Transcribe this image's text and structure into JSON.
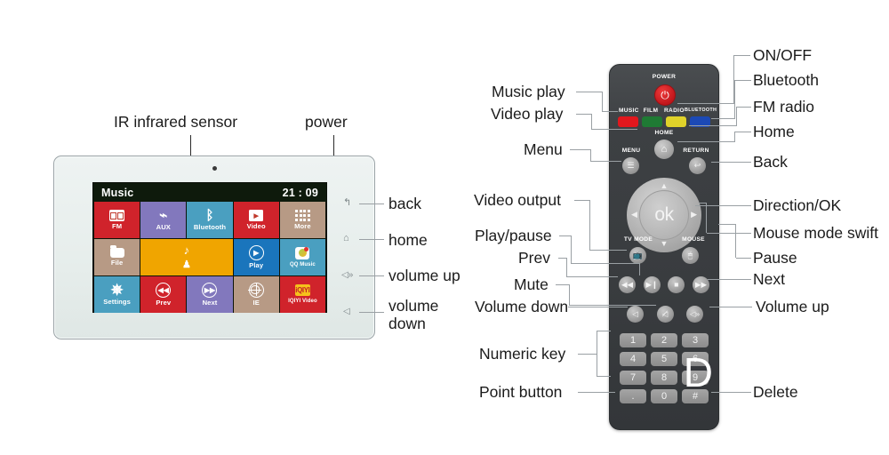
{
  "tablet": {
    "callouts_top": [
      {
        "label": "IR infrared sensor"
      },
      {
        "label": "power"
      }
    ],
    "side_keys": [
      {
        "icon": "back-icon",
        "glyph": "↰",
        "label": "back"
      },
      {
        "icon": "home-icon",
        "glyph": "⌂",
        "label": "home"
      },
      {
        "icon": "volume-up-icon",
        "glyph": "◁»",
        "label": "volume up"
      },
      {
        "icon": "volume-down-icon",
        "glyph": "◁",
        "label": "volume down"
      }
    ],
    "screen": {
      "status_title": "Music",
      "status_time": "21 : 09",
      "tiles": [
        {
          "label": "FM",
          "icon": "fm-radio-icon",
          "color": "#d0232b",
          "span": 1
        },
        {
          "label": "AUX",
          "icon": "aux-cable-icon",
          "color": "#8278bd",
          "span": 1
        },
        {
          "label": "Bluetooth",
          "icon": "bluetooth-icon",
          "color": "#4a9fc0",
          "span": 1
        },
        {
          "label": "Video",
          "icon": "video-icon",
          "color": "#d0232b",
          "span": 1
        },
        {
          "label": "More",
          "icon": "more-dots-icon",
          "color": "#b79a85",
          "span": 1
        },
        {
          "label": "File",
          "icon": "folder-icon",
          "color": "#b79a85",
          "span": 1
        },
        {
          "label": "",
          "icon": "music-note-icon",
          "color": "#f0a500",
          "span": 2
        },
        {
          "label": "Play",
          "icon": "play-icon",
          "color": "#1a75bc",
          "span": 1
        },
        {
          "label": "QQ Music",
          "icon": "qq-music-icon",
          "color": "#4a9fc0",
          "span": 1
        },
        {
          "label": "Settings",
          "icon": "gear-icon",
          "color": "#4a9fc0",
          "span": 1
        },
        {
          "label": "Prev",
          "icon": "prev-icon",
          "color": "#d0232b",
          "span": 1
        },
        {
          "label": "Next",
          "icon": "next-icon",
          "color": "#8278bd",
          "span": 1
        },
        {
          "label": "IE",
          "icon": "globe-icon",
          "color": "#b79a85",
          "span": 1
        },
        {
          "label": "IQIYI Video",
          "icon": "iqiyi-icon",
          "color": "#d0232b",
          "span": 1
        }
      ]
    }
  },
  "remote": {
    "printed_labels": {
      "power": "POWER",
      "music": "MUSIC",
      "film": "FILM",
      "radio": "RADIO",
      "bluetooth": "BLUETOOTH",
      "home": "HOME",
      "menu": "MENU",
      "return": "RETURN",
      "tv_mode": "TV MODE",
      "mouse": "MOUSE",
      "ok": "ok"
    },
    "color_buttons": [
      {
        "name": "music",
        "color": "#e1171d"
      },
      {
        "name": "film",
        "color": "#1f7a34"
      },
      {
        "name": "radio",
        "color": "#e0d22a"
      },
      {
        "name": "bluetooth",
        "color": "#1c49b5"
      }
    ],
    "media_buttons": [
      {
        "name": "prev",
        "glyph": "◀◀"
      },
      {
        "name": "play-pause",
        "glyph": "▶❙"
      },
      {
        "name": "stop-pause",
        "glyph": "■"
      },
      {
        "name": "next",
        "glyph": "▶▶"
      }
    ],
    "volume_buttons": [
      {
        "name": "volume-down",
        "glyph": "◁"
      },
      {
        "name": "mute",
        "glyph": "◁̸"
      },
      {
        "name": "volume-up",
        "glyph": "◁»"
      }
    ],
    "keypad": [
      "1",
      "2",
      "3",
      "4",
      "5",
      "6",
      "7",
      "8",
      "9",
      ".",
      "0",
      "#"
    ],
    "delete_watermark": "D"
  },
  "callouts_left": [
    {
      "label": "Music play"
    },
    {
      "label": "Video play"
    },
    {
      "label": "Menu"
    },
    {
      "label": "Video output"
    },
    {
      "label": "Play/pause"
    },
    {
      "label": "Prev"
    },
    {
      "label": "Mute"
    },
    {
      "label": "Volume down"
    },
    {
      "label": "Numeric key"
    },
    {
      "label": "Point button"
    }
  ],
  "callouts_right": [
    {
      "label": "ON/OFF"
    },
    {
      "label": "Bluetooth"
    },
    {
      "label": "FM radio"
    },
    {
      "label": "Home"
    },
    {
      "label": "Back"
    },
    {
      "label": "Direction/OK"
    },
    {
      "label": "Mouse mode swift"
    },
    {
      "label": "Pause"
    },
    {
      "label": "Next"
    },
    {
      "label": "Volume up"
    },
    {
      "label": "Delete"
    }
  ]
}
